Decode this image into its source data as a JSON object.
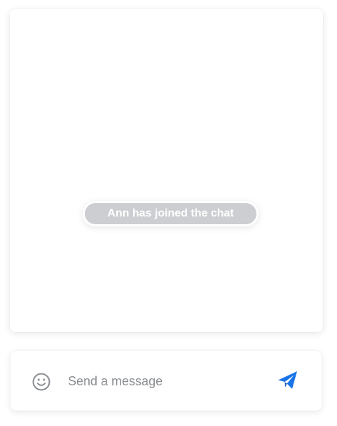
{
  "chat": {
    "system_message": "Ann has joined the chat"
  },
  "composer": {
    "placeholder": "Send a message",
    "emoji_icon": "smiley-face-icon",
    "send_icon": "paper-plane-send-icon"
  },
  "colors": {
    "accent": "#1a73e8",
    "pill_background": "#ccced1",
    "icon_gray": "#8a8d91"
  }
}
